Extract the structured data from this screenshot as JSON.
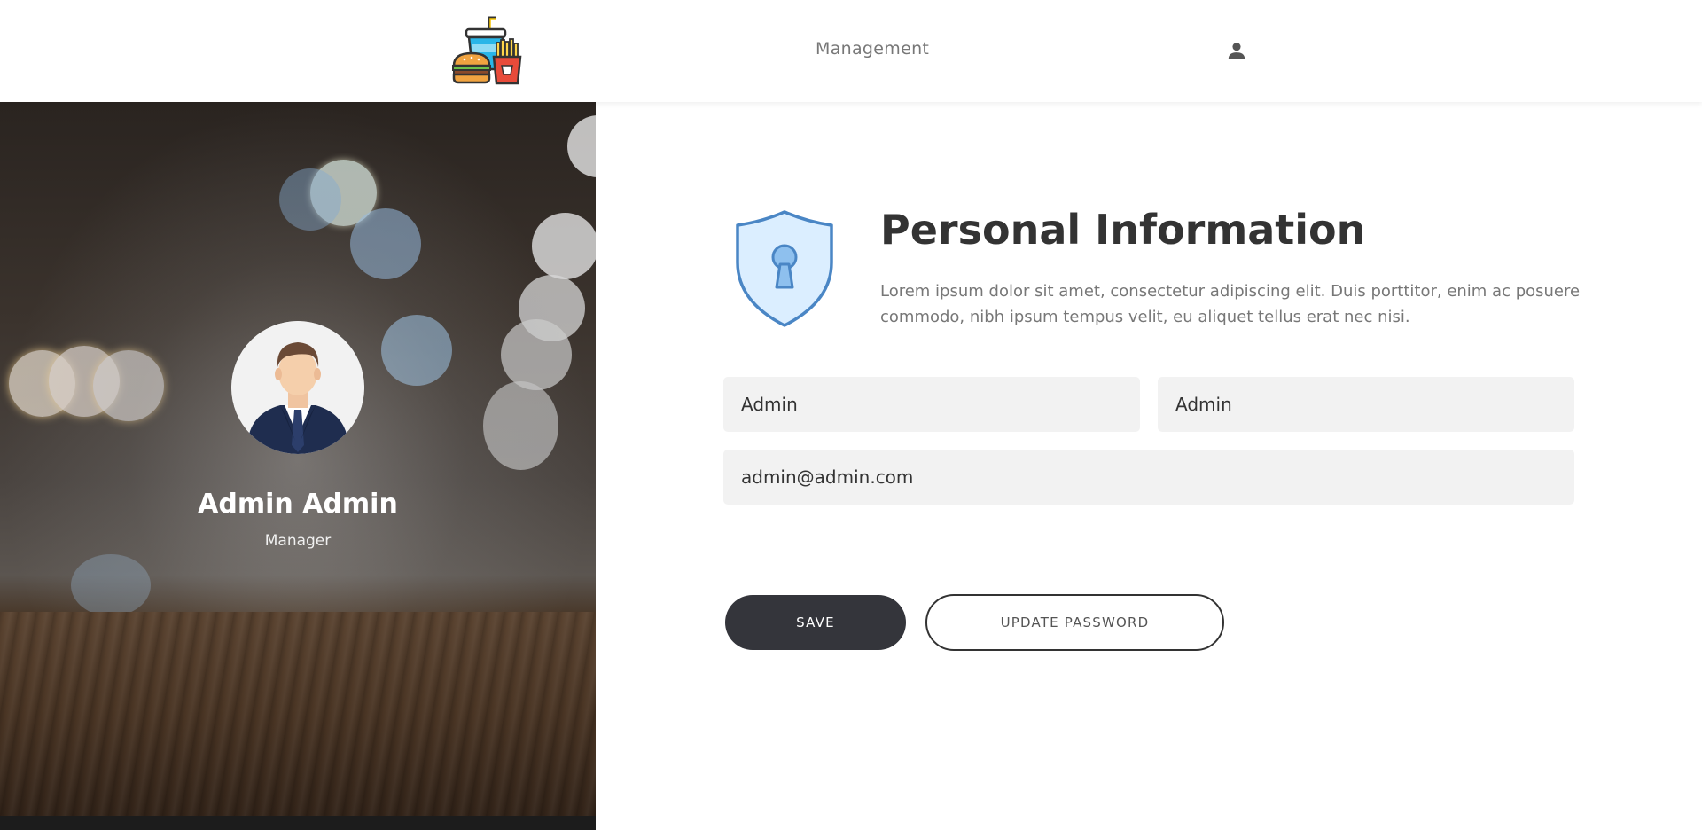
{
  "header": {
    "logo_icon": "fast-food-logo-icon",
    "nav_management": "Management",
    "user_icon": "user-account-icon"
  },
  "profile": {
    "name": "Admin Admin",
    "role": "Manager",
    "avatar_icon": "businessman-avatar"
  },
  "form": {
    "icon": "shield-keyhole-icon",
    "title": "Personal Information",
    "description": "Lorem ipsum dolor sit amet, consectetur adipiscing elit. Duis porttitor, enim ac posuere commodo, nibh ipsum tempus velit, eu aliquet tellus erat nec nisi.",
    "first_name": "Admin",
    "last_name": "Admin",
    "email": "admin@admin.com",
    "save_label": "SAVE",
    "update_password_label": "UPDATE PASSWORD"
  },
  "colors": {
    "primary_button": "#34353b",
    "shield_blue": "#4a86c5",
    "shield_fill": "#dbeeff",
    "field_bg": "#f2f2f2"
  }
}
